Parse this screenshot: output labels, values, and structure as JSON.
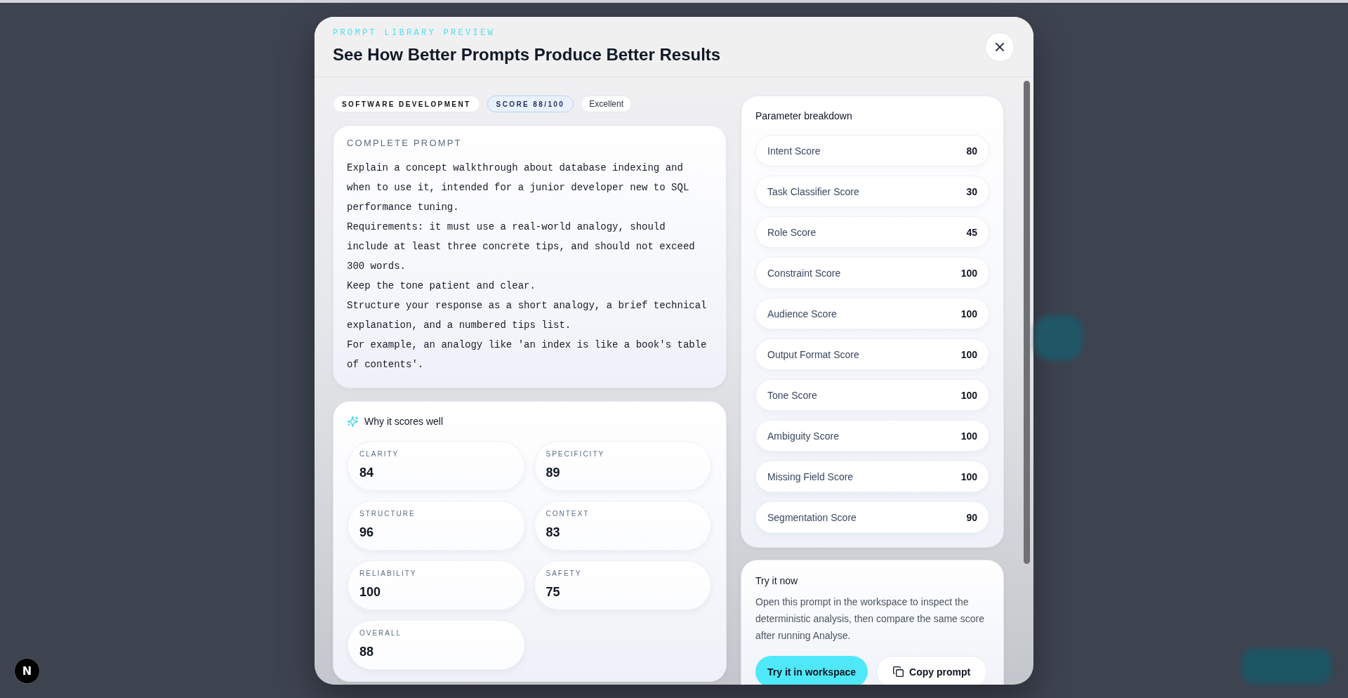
{
  "modal": {
    "eyebrow": "PROMPT LIBRARY PREVIEW",
    "title": "See How Better Prompts Produce Better Results"
  },
  "tags": [
    {
      "kind": "category",
      "label": "SOFTWARE DEVELOPMENT"
    },
    {
      "kind": "score",
      "label": "SCORE 88/100"
    },
    {
      "kind": "rating",
      "label": "Excellent"
    }
  ],
  "prompt_card": {
    "heading": "COMPLETE PROMPT",
    "paragraphs": [
      "Explain a concept walkthrough about database indexing and when to use it, intended for a junior developer new to SQL performance tuning.",
      "Requirements: it must use a real-world analogy, should include at least three concrete tips, and should not exceed 300 words.",
      "Keep the tone patient and clear.",
      "Structure your response as a short analogy, a brief technical explanation, and a numbered tips list.",
      "For example, an analogy like 'an index is like a book's table of contents'."
    ]
  },
  "why_card": {
    "heading": "Why it scores well",
    "metrics": [
      {
        "label": "CLARITY",
        "value": "84"
      },
      {
        "label": "SPECIFICITY",
        "value": "89"
      },
      {
        "label": "STRUCTURE",
        "value": "96"
      },
      {
        "label": "CONTEXT",
        "value": "83"
      },
      {
        "label": "RELIABILITY",
        "value": "100"
      },
      {
        "label": "SAFETY",
        "value": "75"
      },
      {
        "label": "OVERALL",
        "value": "88"
      }
    ]
  },
  "breakdown": {
    "heading": "Parameter breakdown",
    "rows": [
      {
        "label": "Intent Score",
        "value": "80"
      },
      {
        "label": "Task Classifier Score",
        "value": "30"
      },
      {
        "label": "Role Score",
        "value": "45"
      },
      {
        "label": "Constraint Score",
        "value": "100"
      },
      {
        "label": "Audience Score",
        "value": "100"
      },
      {
        "label": "Output Format Score",
        "value": "100"
      },
      {
        "label": "Tone Score",
        "value": "100"
      },
      {
        "label": "Ambiguity Score",
        "value": "100"
      },
      {
        "label": "Missing Field Score",
        "value": "100"
      },
      {
        "label": "Segmentation Score",
        "value": "90"
      }
    ]
  },
  "try_card": {
    "heading": "Try it now",
    "text": "Open this prompt in the workspace to inspect the deterministic analysis, then compare the same score after running Analyse.",
    "buttons": [
      {
        "kind": "primary",
        "label": "Try it in workspace"
      },
      {
        "kind": "copy",
        "label": "Copy prompt"
      }
    ]
  },
  "dev_badge": {
    "label": "N"
  }
}
